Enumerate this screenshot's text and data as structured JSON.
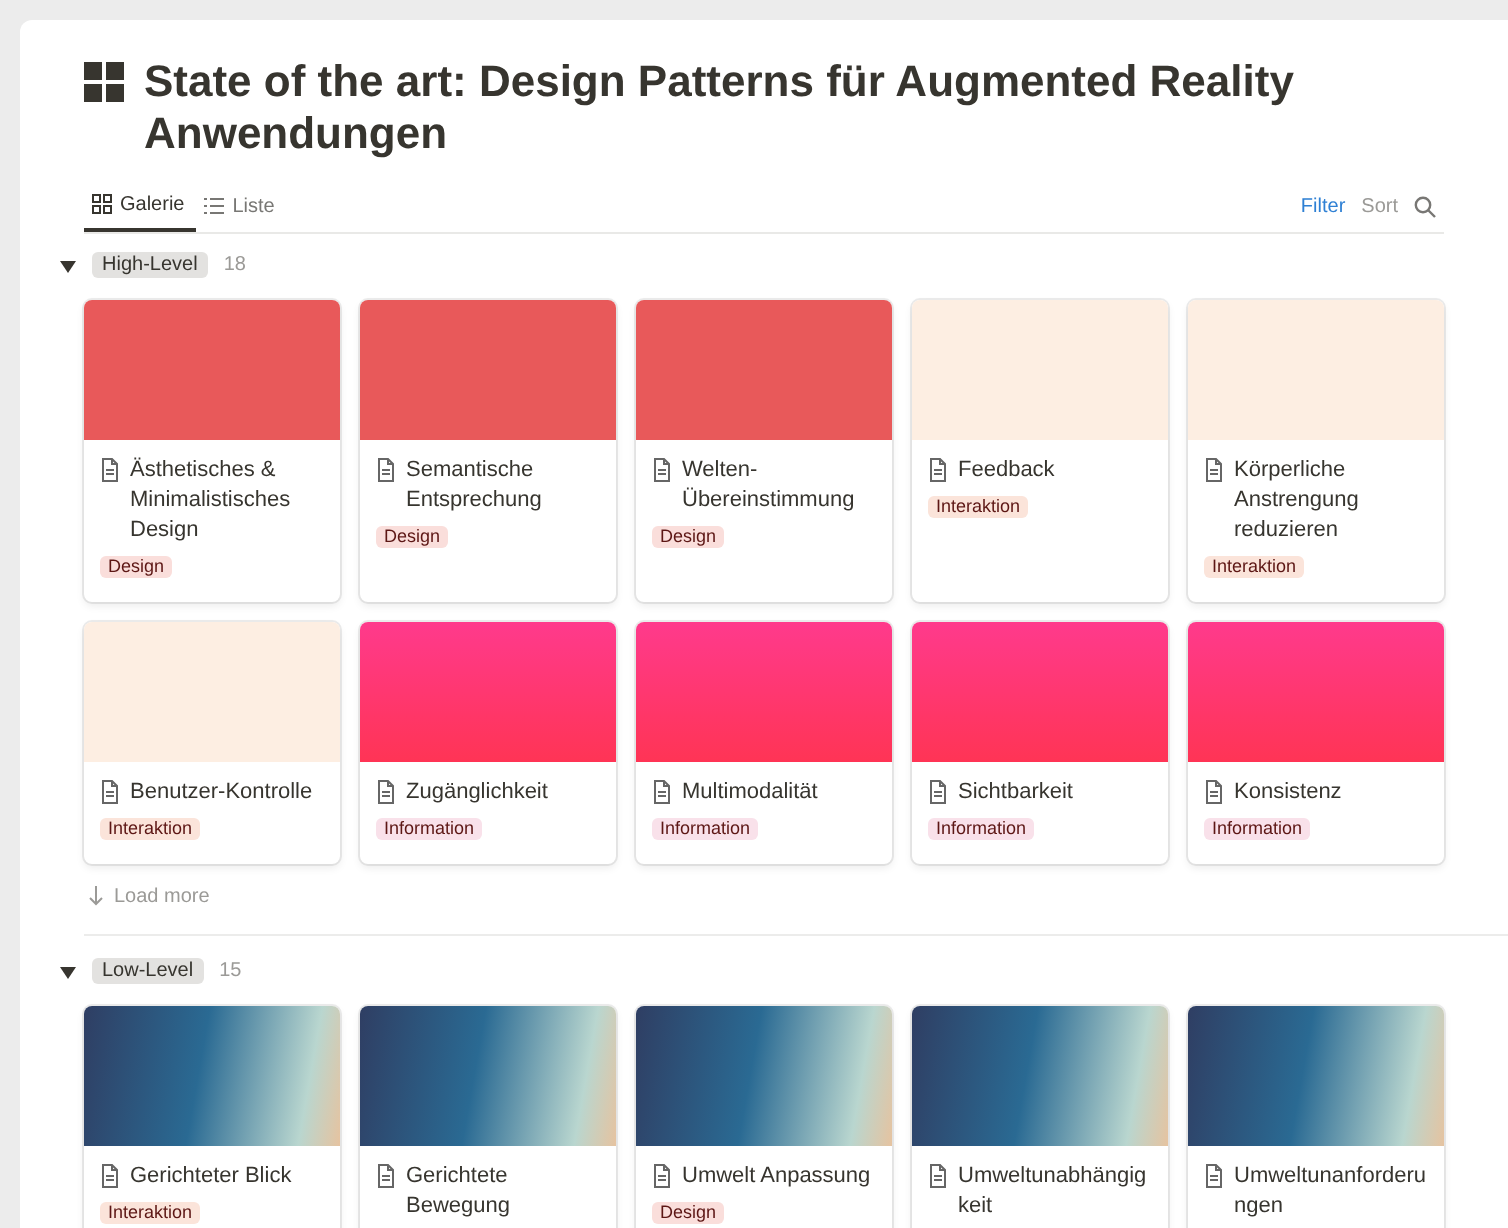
{
  "page": {
    "title": "State of the art: Design Patterns für Augmented Reality Anwendungen"
  },
  "tabs": [
    {
      "label": "Galerie",
      "kind": "gallery",
      "selected": true
    },
    {
      "label": "Liste",
      "kind": "list",
      "selected": false
    }
  ],
  "toolbar": {
    "filter": "Filter",
    "sort": "Sort"
  },
  "groups": [
    {
      "name": "High-Level",
      "count": "18",
      "expanded": true,
      "load_more": "Load more",
      "cards": [
        {
          "title": "Ästhetisches & Minimalistisches Design",
          "kind": "red",
          "tag": {
            "label": "Design",
            "color": "#fadedb"
          }
        },
        {
          "title": "Semantische Entsprechung",
          "kind": "red",
          "tag": {
            "label": "Design",
            "color": "#fadedb"
          }
        },
        {
          "title": "Welten-Übereinstimmung",
          "kind": "red",
          "tag": {
            "label": "Design",
            "color": "#fadedb"
          }
        },
        {
          "title": "Feedback",
          "kind": "peach",
          "tag": {
            "label": "Interaktion",
            "color": "#fbe4da"
          }
        },
        {
          "title": "Körperliche Anstrengung reduzieren",
          "kind": "peach",
          "tag": {
            "label": "Interaktion",
            "color": "#fbe4da"
          }
        },
        {
          "title": "Benutzer-Kontrolle",
          "kind": "peach",
          "tag": {
            "label": "Interaktion",
            "color": "#fbe4da"
          }
        },
        {
          "title": "Zugänglichkeit",
          "kind": "pink",
          "tag": {
            "label": "Information",
            "color": "#f9e1ea"
          }
        },
        {
          "title": "Multimodalität",
          "kind": "pink",
          "tag": {
            "label": "Information",
            "color": "#f9e1ea"
          }
        },
        {
          "title": "Sichtbarkeit",
          "kind": "pink",
          "tag": {
            "label": "Information",
            "color": "#f9e1ea"
          }
        },
        {
          "title": "Konsistenz",
          "kind": "pink",
          "tag": {
            "label": "Information",
            "color": "#f9e1ea"
          }
        }
      ]
    },
    {
      "name": "Low-Level",
      "count": "15",
      "expanded": true,
      "cards": [
        {
          "title": "Gerichteter Blick",
          "kind": "ocean",
          "tag": {
            "label": "Interaktion",
            "color": "#fbe4da"
          }
        },
        {
          "title": "Gerichtete Bewegung",
          "kind": "ocean"
        },
        {
          "title": "Umwelt Anpassung",
          "kind": "ocean",
          "tag": {
            "label": "Design",
            "color": "#fadedb"
          }
        },
        {
          "title": "Umweltunabhängigkeit",
          "kind": "ocean"
        },
        {
          "title": "Umweltunanforderungen",
          "kind": "ocean"
        }
      ]
    }
  ]
}
